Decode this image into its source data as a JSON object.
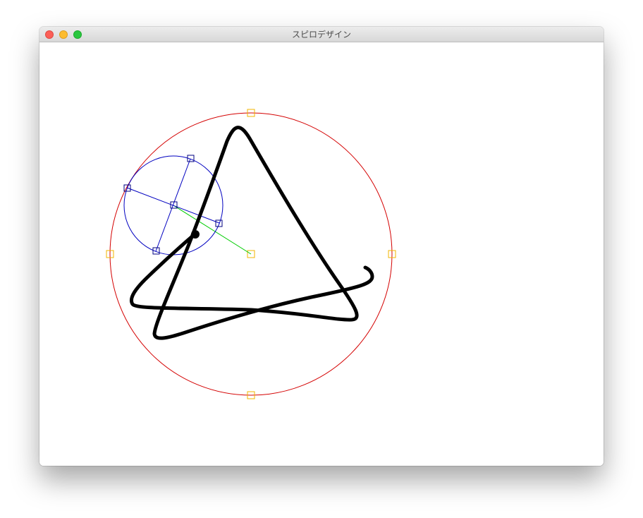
{
  "window": {
    "title": "スピロデザイン"
  },
  "colors": {
    "outer_circle": "#d40000",
    "inner_circle": "#0000c0",
    "spoke": "#0000c0",
    "arm": "#00cc00",
    "outer_handle": "#f0b400",
    "inner_handle": "#000080",
    "trace": "#000000",
    "pen": "#000000"
  },
  "icons": [
    "close-icon",
    "minimize-icon",
    "zoom-icon"
  ]
}
